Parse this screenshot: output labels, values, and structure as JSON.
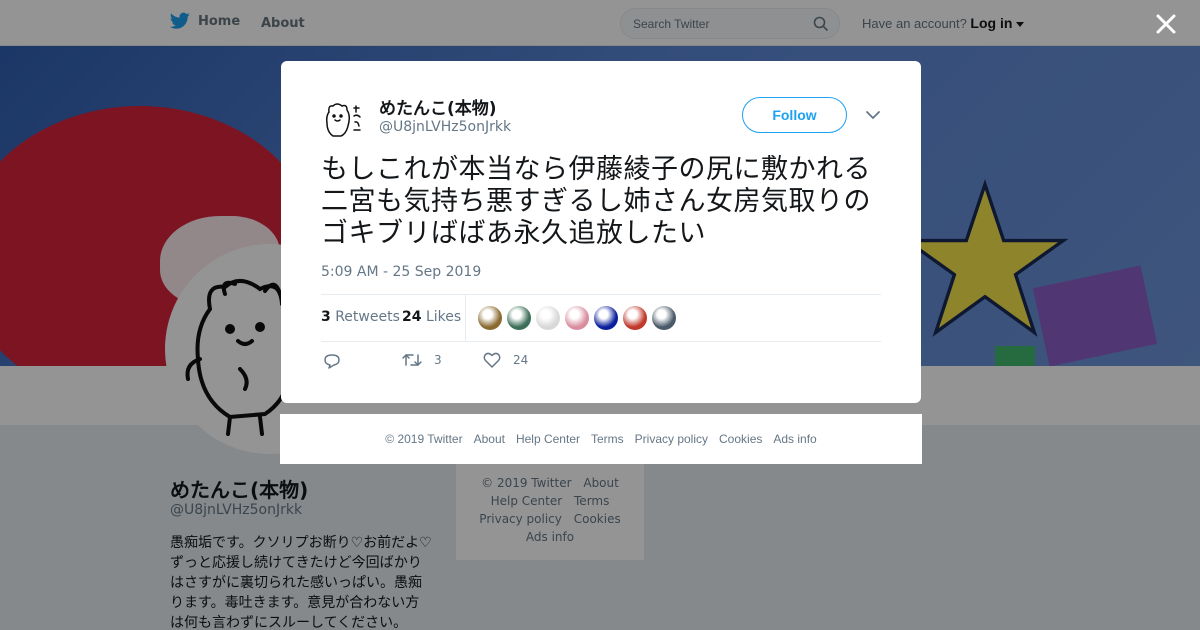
{
  "topbar": {
    "home_label": "Home",
    "about_label": "About",
    "search_placeholder": "Search Twitter",
    "have_account": "Have an account?",
    "login_label": "Log in"
  },
  "profile": {
    "name": "めたんこ(本物)",
    "handle": "@U8jnLVHz5onJrkk",
    "bio": "愚痴垢です。クソリプお断り♡お前だよ♡ ずっと応援し続けてきたけど今回ばかりはさすがに裏切られた感いっぱい。愚痴ります。毒吐きます。意見が合わない方は何も言わずにスルーしてください。"
  },
  "bg_footer": {
    "links": [
      "© 2019 Twitter",
      "About",
      "Help Center",
      "Terms",
      "Privacy policy",
      "Cookies",
      "Ads info"
    ]
  },
  "tweet": {
    "name": "めたんこ(本物)",
    "handle": "@U8jnLVHz5onJrkk",
    "follow_label": "Follow",
    "text": "もしこれが本当なら伊藤綾子の尻に敷かれる二宮も気持ち悪すぎるし姉さん女房気取りのゴキブリばばあ永久追放したい",
    "timestamp": "5:09 AM - 25 Sep 2019",
    "retweets_count": "3",
    "retweets_label": "Retweets",
    "likes_count": "24",
    "likes_label": "Likes",
    "likers": [
      "#8a6a30",
      "#3c6e58",
      "#d8d8d8",
      "#d98ea0",
      "#0b1f9c",
      "#c0392b",
      "#4a5a6a"
    ],
    "action_retweet_count": "3",
    "action_like_count": "24"
  },
  "modal_footer": {
    "links": [
      "© 2019 Twitter",
      "About",
      "Help Center",
      "Terms",
      "Privacy policy",
      "Cookies",
      "Ads info"
    ]
  },
  "colors": {
    "accent": "#1da1f2",
    "muted": "#657786",
    "overlay": "rgba(0,0,0,0.42)"
  }
}
